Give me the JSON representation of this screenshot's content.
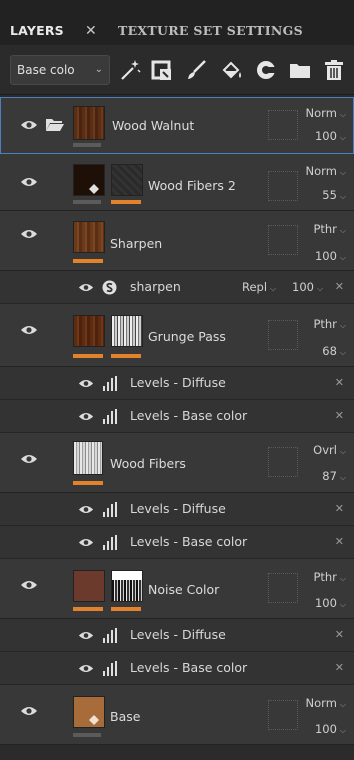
{
  "tabs": {
    "layers_label": "LAYERS",
    "layers_close": "✕",
    "texture_set_label": "TEXTURE SET SETTINGS"
  },
  "toolbar": {
    "channel_value": "Base colo",
    "channel_chevron": "⌄",
    "tools": [
      "magic-wand-icon",
      "fill-layer-icon",
      "paint-brush-icon",
      "fill-bucket-icon",
      "smart-material-icon",
      "folder-icon",
      "delete-icon"
    ]
  },
  "layers": [
    {
      "name": "Wood Walnut",
      "blend": "Norm",
      "opacity": "100",
      "selected": true,
      "folder": true
    },
    {
      "name": "Wood Fibers 2",
      "blend": "Norm",
      "opacity": "55"
    },
    {
      "name": "Sharpen",
      "blend": "Pthr",
      "opacity": "100"
    },
    {
      "name": "Grunge Pass",
      "blend": "Pthr",
      "opacity": "68"
    },
    {
      "name": "Wood Fibers",
      "blend": "Ovrl",
      "opacity": "87"
    },
    {
      "name": "Noise Color",
      "blend": "Pthr",
      "opacity": "100"
    },
    {
      "name": "Base",
      "blend": "Norm",
      "opacity": "100"
    }
  ],
  "sublayers": {
    "sharpen": {
      "name": "sharpen",
      "mode": "Repl",
      "opacity": "100",
      "close": "✕"
    },
    "levels_diffuse": "Levels - Diffuse",
    "levels_base": "Levels - Base color",
    "close": "✕"
  },
  "colors": {
    "accent_orange": "#e2822c",
    "selection_blue": "#4a7fc0"
  }
}
